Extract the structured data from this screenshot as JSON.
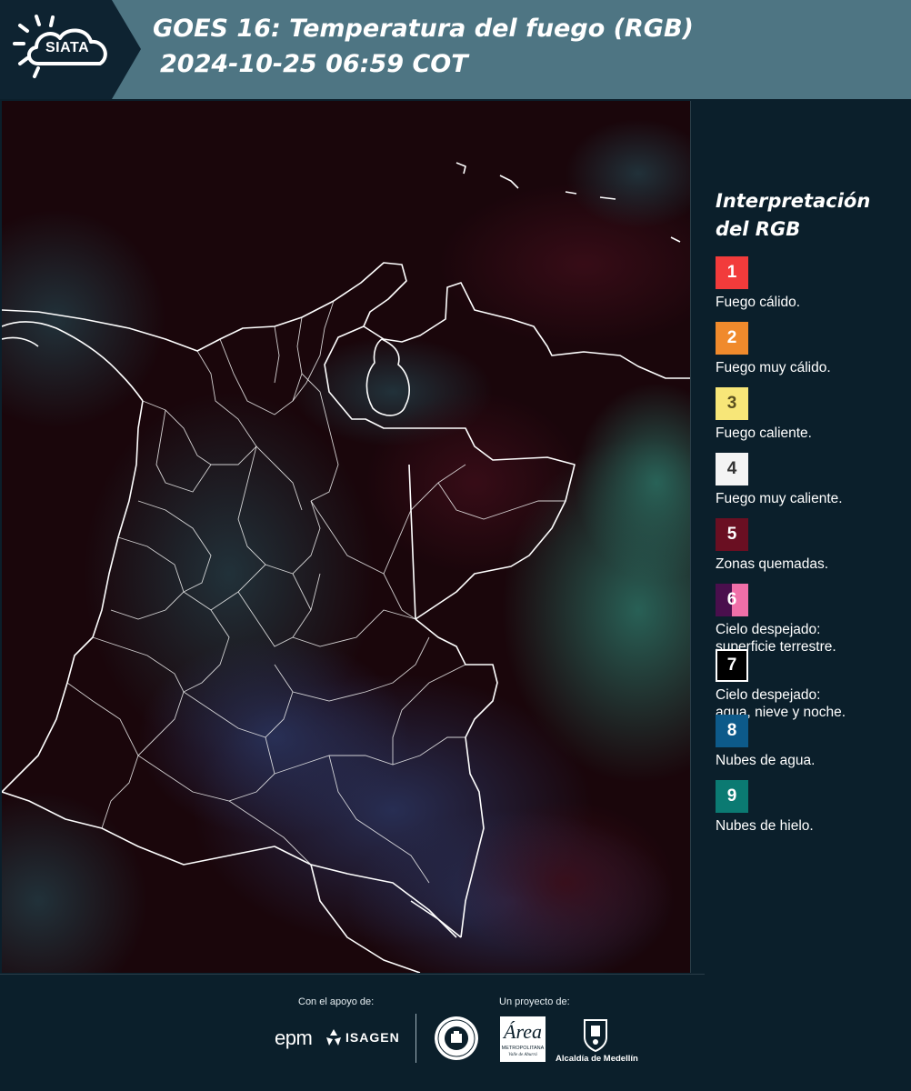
{
  "header": {
    "logo_text": "SIATA",
    "title_line1": "GOES 16: Temperatura del fuego (RGB)",
    "title_line2": "2024-10-25 06:59 COT"
  },
  "colors": {
    "header_dark": "#0e2331",
    "header_accent": "#4e7583",
    "page_background": "#0b1f2b",
    "map_background": "#1a060b",
    "border_lines": "#ffffff"
  },
  "legend": {
    "title_line1": "Interpretación",
    "title_line2": "del RGB",
    "items": [
      {
        "number": "1",
        "label_line1": "Fuego cálido.",
        "label_line2": "",
        "color": "#f23b3b",
        "number_color": "#ffffff"
      },
      {
        "number": "2",
        "label_line1": "Fuego muy cálido.",
        "label_line2": "",
        "color": "#f08a2c",
        "number_color": "#ffffff"
      },
      {
        "number": "3",
        "label_line1": "Fuego caliente.",
        "label_line2": "",
        "color": "#f7e678",
        "number_color": "#5a5020"
      },
      {
        "number": "4",
        "label_line1": "Fuego muy caliente.",
        "label_line2": "",
        "color": "#f4f4f4",
        "number_color": "#333333"
      },
      {
        "number": "5",
        "label_line1": "Zonas quemadas.",
        "label_line2": "",
        "color": "#6a0f22",
        "number_color": "#ffffff"
      },
      {
        "number": "6",
        "label_line1": "Cielo despejado:",
        "label_line2": "superficie terrestre.",
        "color": "#4a0f4d",
        "color_right": "#f06fa8",
        "number_color": "#ffffff"
      },
      {
        "number": "7",
        "label_line1": "Cielo despejado:",
        "label_line2": "agua, nieve y noche.",
        "color": "#000000",
        "number_color": "#ffffff",
        "bordered": true
      },
      {
        "number": "8",
        "label_line1": "Nubes de agua.",
        "label_line2": "",
        "color": "#0d5a8a",
        "number_color": "#ffffff"
      },
      {
        "number": "9",
        "label_line1": "Nubes de hielo.",
        "label_line2": "",
        "color": "#0b7a72",
        "number_color": "#ffffff"
      }
    ]
  },
  "footer": {
    "support_label": "Con el apoyo de:",
    "project_label": "Un proyecto de:",
    "sponsor_epm": "epm",
    "sponsor_isagen": "ISAGEN",
    "amva_logo_letter": "Área",
    "amva_name": "METROPOLITANA",
    "amva_sub": "Valle de Aburrá",
    "alcaldia": "Alcaldía de Medellín"
  },
  "map": {
    "description_icon": "satellite-composite-map"
  }
}
